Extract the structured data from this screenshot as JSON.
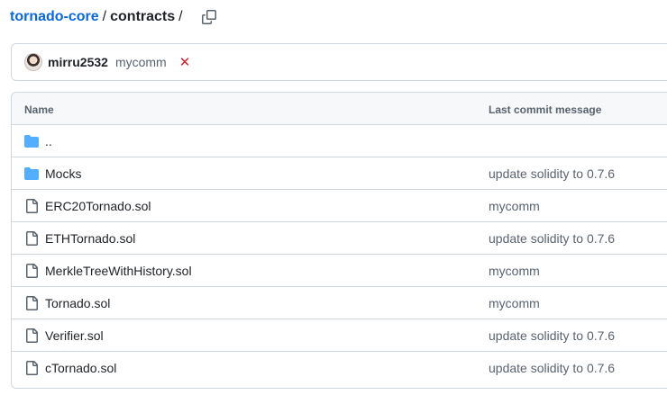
{
  "breadcrumb": {
    "repo": "tornado-core",
    "separator": "/",
    "dir": "contracts",
    "trailing": "/"
  },
  "commit": {
    "user": "mirru2532",
    "message": "mycomm",
    "status_icon": "x-icon",
    "status_symbol": "✕",
    "status_color": "#cf222e"
  },
  "table": {
    "headers": {
      "name": "Name",
      "last_commit": "Last commit message"
    },
    "rows": [
      {
        "type": "parent-dir",
        "name": "..",
        "message": ""
      },
      {
        "type": "folder",
        "name": "Mocks",
        "message": "update solidity to 0.7.6"
      },
      {
        "type": "file",
        "name": "ERC20Tornado.sol",
        "message": "mycomm"
      },
      {
        "type": "file",
        "name": "ETHTornado.sol",
        "message": "update solidity to 0.7.6"
      },
      {
        "type": "file",
        "name": "MerkleTreeWithHistory.sol",
        "message": "mycomm"
      },
      {
        "type": "file",
        "name": "Tornado.sol",
        "message": "mycomm"
      },
      {
        "type": "file",
        "name": "Verifier.sol",
        "message": "update solidity to 0.7.6"
      },
      {
        "type": "file",
        "name": "cTornado.sol",
        "message": "update solidity to 0.7.6"
      }
    ]
  },
  "colors": {
    "link": "#0969da",
    "folder": "#54aeff",
    "muted": "#59636e",
    "border": "#d0d7de"
  }
}
